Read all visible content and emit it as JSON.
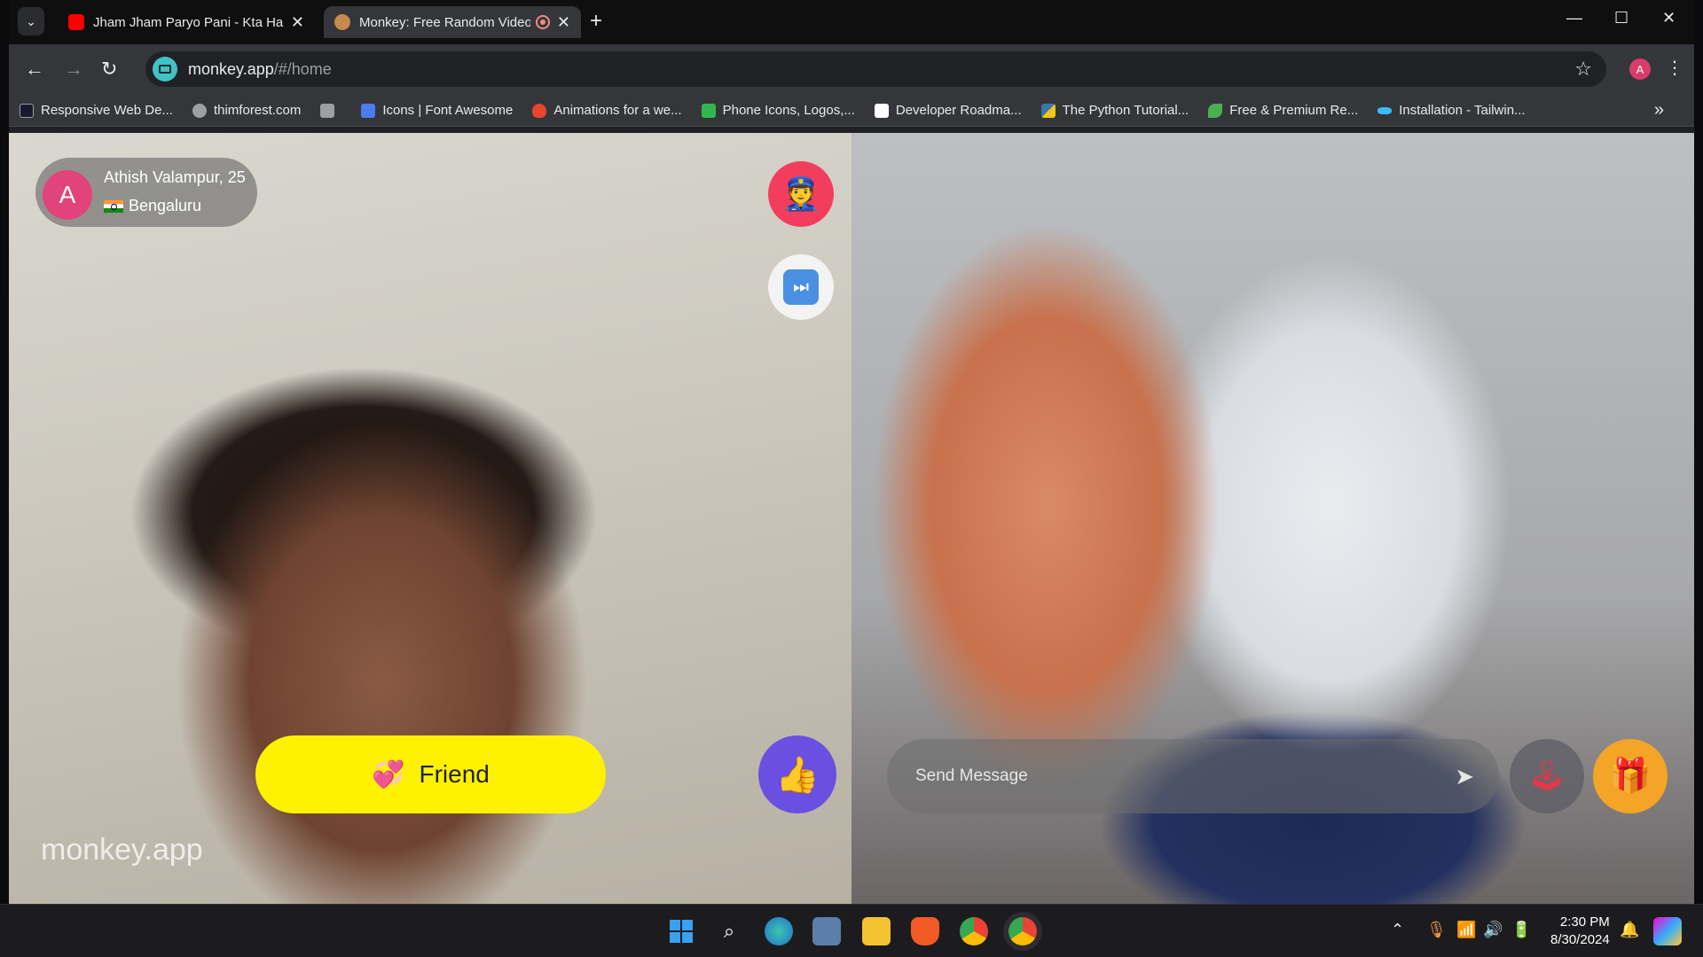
{
  "browser": {
    "tabs": [
      {
        "title": "Jham Jham Paryo Pani - Kta Har",
        "active": false
      },
      {
        "title": "Monkey: Free Random Video Chat",
        "active": true
      }
    ],
    "url_host": "monkey.app",
    "url_path": "/#/home",
    "profile_initial": "A"
  },
  "bookmarks": [
    {
      "label": "Responsive Web De...",
      "icon": "code-icon",
      "color": "#1a1a2e"
    },
    {
      "label": "thimforest.com",
      "icon": "globe-icon",
      "color": "#9aa0a6"
    },
    {
      "label": "",
      "icon": "contact-icon",
      "color": "#9aa0a6"
    },
    {
      "label": "Icons | Font Awesome",
      "icon": "flag-icon",
      "color": "#4a7cf0"
    },
    {
      "label": "Animations for a we...",
      "icon": "flame-icon",
      "color": "#e8452c"
    },
    {
      "label": "Phone Icons, Logos,...",
      "icon": "square-icon",
      "color": "#2fb84f"
    },
    {
      "label": "Developer Roadma...",
      "icon": "roadmap-icon",
      "color": "#ffffff"
    },
    {
      "label": "The Python Tutorial...",
      "icon": "python-icon",
      "color": "#f5c518"
    },
    {
      "label": "Free & Premium Re...",
      "icon": "leaf-icon",
      "color": "#4caf50"
    },
    {
      "label": "Installation - Tailwin...",
      "icon": "tailwind-icon",
      "color": "#38bdf8"
    }
  ],
  "left_panel": {
    "user_initial": "A",
    "user_name": "Athish Valampur, 25",
    "user_location": "Bengaluru",
    "friend_label": "Friend",
    "watermark": "monkey.app"
  },
  "right_panel": {
    "message_placeholder": "Send Message"
  },
  "taskbar": {
    "time": "2:30 PM",
    "date": "8/30/2024"
  },
  "colors": {
    "friend_button": "#fff200",
    "like_button": "#6a4fe3",
    "report_button": "#f23d5e",
    "gift_button": "#f4a426"
  }
}
